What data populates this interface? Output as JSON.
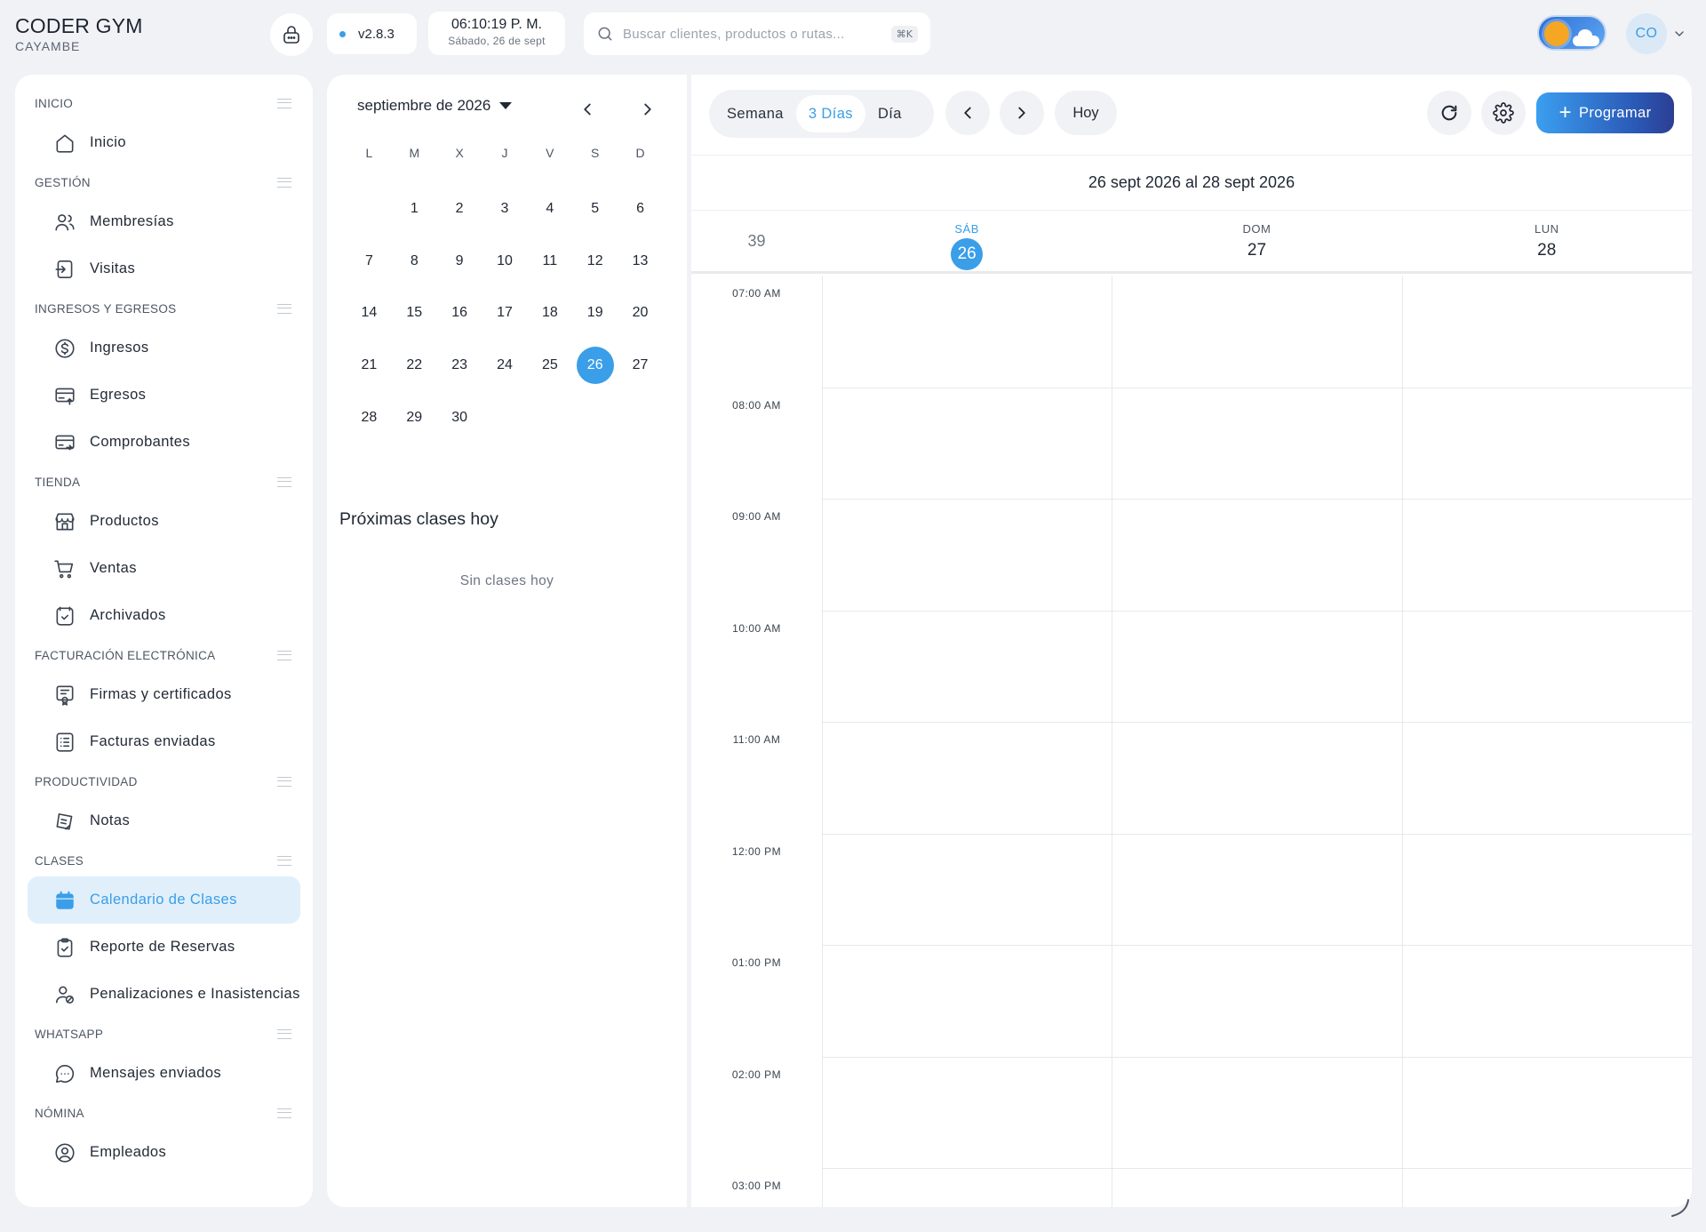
{
  "brand": {
    "name": "CODER GYM",
    "location": "CAYAMBE"
  },
  "header": {
    "version": "v2.8.3",
    "clock_time": "06:10:19 P. M.",
    "clock_date": "Sábado, 26 de sept",
    "search_placeholder": "Buscar clientes, productos o rutas...",
    "search_shortcut": "⌘K",
    "avatar_initials": "CO"
  },
  "sidebar": {
    "sections": [
      {
        "title": "INICIO",
        "items": [
          {
            "label": "Inicio",
            "icon": "home-icon"
          }
        ]
      },
      {
        "title": "GESTIÓN",
        "items": [
          {
            "label": "Membresías",
            "icon": "users-icon"
          },
          {
            "label": "Visitas",
            "icon": "login-icon"
          }
        ]
      },
      {
        "title": "INGRESOS Y EGRESOS",
        "items": [
          {
            "label": "Ingresos",
            "icon": "dollar-icon"
          },
          {
            "label": "Egresos",
            "icon": "card-out-icon"
          },
          {
            "label": "Comprobantes",
            "icon": "card-swap-icon"
          }
        ]
      },
      {
        "title": "TIENDA",
        "items": [
          {
            "label": "Productos",
            "icon": "store-icon"
          },
          {
            "label": "Ventas",
            "icon": "cart-icon"
          },
          {
            "label": "Archivados",
            "icon": "archive-check-icon"
          }
        ]
      },
      {
        "title": "FACTURACIÓN ELECTRÓNICA",
        "items": [
          {
            "label": "Firmas y certificados",
            "icon": "certificate-icon"
          },
          {
            "label": "Facturas enviadas",
            "icon": "invoice-icon"
          }
        ]
      },
      {
        "title": "PRODUCTIVIDAD",
        "items": [
          {
            "label": "Notas",
            "icon": "notes-icon"
          }
        ]
      },
      {
        "title": "CLASES",
        "items": [
          {
            "label": "Calendario de Clases",
            "icon": "calendar-icon",
            "active": true
          },
          {
            "label": "Reporte de Reservas",
            "icon": "clipboard-check-icon"
          },
          {
            "label": "Penalizaciones e Inasistencias",
            "icon": "user-block-icon"
          }
        ]
      },
      {
        "title": "WHATSAPP",
        "items": [
          {
            "label": "Mensajes enviados",
            "icon": "chat-icon"
          }
        ]
      },
      {
        "title": "NÓMINA",
        "items": [
          {
            "label": "Empleados",
            "icon": "user-circle-icon"
          }
        ]
      }
    ]
  },
  "mini_calendar": {
    "month_label": "septiembre de 2026",
    "weekdays": [
      "L",
      "M",
      "X",
      "J",
      "V",
      "S",
      "D"
    ],
    "leading_blanks": 1,
    "days": [
      "1",
      "2",
      "3",
      "4",
      "5",
      "6",
      "7",
      "8",
      "9",
      "10",
      "11",
      "12",
      "13",
      "14",
      "15",
      "16",
      "17",
      "18",
      "19",
      "20",
      "21",
      "22",
      "23",
      "24",
      "25",
      "26",
      "27",
      "28",
      "29",
      "30"
    ],
    "selected_day": "26"
  },
  "upcoming": {
    "title": "Próximas clases hoy",
    "empty_text": "Sin clases hoy"
  },
  "calendar": {
    "views": [
      {
        "label": "Semana",
        "active": false
      },
      {
        "label": "3 Días",
        "active": true
      },
      {
        "label": "Día",
        "active": false
      }
    ],
    "today_label": "Hoy",
    "program_label": "Programar",
    "range_label": "26 sept 2026 al 28 sept 2026",
    "week_number": "39",
    "days": [
      {
        "name": "SÁB",
        "num": "26",
        "today": true
      },
      {
        "name": "DOM",
        "num": "27",
        "today": false
      },
      {
        "name": "LUN",
        "num": "28",
        "today": false
      }
    ],
    "hours": [
      "07:00 AM",
      "08:00 AM",
      "09:00 AM",
      "10:00 AM",
      "11:00 AM",
      "12:00 PM",
      "01:00 PM",
      "02:00 PM",
      "03:00 PM"
    ]
  },
  "colors": {
    "accent": "#3a9ee8",
    "background": "#f1f2f5",
    "active_bg": "#e1effb"
  }
}
